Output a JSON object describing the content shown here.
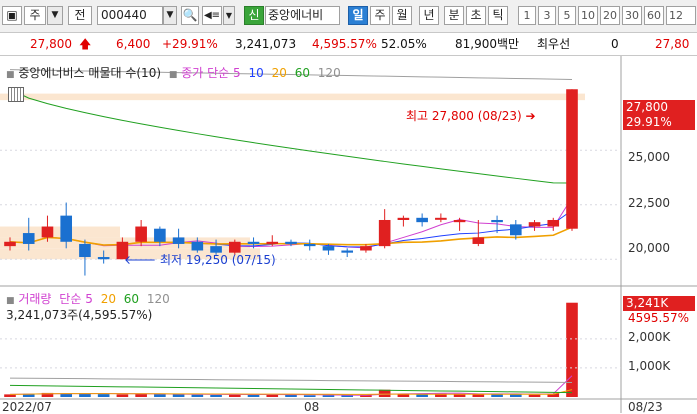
{
  "toolbar": {
    "period": "주",
    "jeon": "전",
    "code": "000440",
    "sin": "신",
    "stock_name": "중앙에너비",
    "tabs": [
      "일",
      "주",
      "월",
      "년",
      "분",
      "초",
      "틱"
    ],
    "numbers": [
      "1",
      "3",
      "5",
      "10",
      "20",
      "30",
      "60",
      "12"
    ]
  },
  "quote": {
    "price": "27,800",
    "change": "6,400",
    "change_pct": "+29.91%",
    "volume": "3,241,073",
    "volume_pct": "4,595.57%",
    "ratio": "52.05%",
    "amount": "81,900백만",
    "best_ask": "최우선",
    "zero": "0",
    "ask_price": "27,80"
  },
  "price_panel": {
    "title": "중앙에너비스 매물대 수(10)",
    "ma_label": "종가 단순",
    "ma_periods": [
      "5",
      "10",
      "20",
      "60",
      "120"
    ],
    "high_label": "최고 27,800 (08/23)",
    "low_label": "최저 19,250 (07/15)",
    "last_price": "27,800",
    "last_pct": "29.91%",
    "y_ticks": [
      "25,000",
      "22,500",
      "20,000"
    ]
  },
  "volume_panel": {
    "title": "거래량",
    "ma_label": "단순",
    "ma_periods": [
      "5",
      "20",
      "60",
      "120"
    ],
    "info": "3,241,073주(4,595.57%)",
    "last_volume": "3,241K",
    "last_pct": "4595.57%",
    "y_ticks": [
      "2,000K",
      "1,000K"
    ]
  },
  "x_axis": {
    "left": "2022/07",
    "mid": "08",
    "right": "08/23"
  },
  "colors": {
    "up": "#e02020",
    "down": "#1a70d0",
    "ma5": "#d040d0",
    "ma10": "#2040ff",
    "ma20": "#f0a000",
    "ma60": "#20a020",
    "ma120": "#a0a0a0"
  },
  "chart_data": {
    "type": "candlestick",
    "x": [
      "07/11",
      "07/12",
      "07/13",
      "07/14",
      "07/15",
      "07/18",
      "07/19",
      "07/20",
      "07/21",
      "07/22",
      "07/25",
      "07/26",
      "07/27",
      "07/28",
      "07/29",
      "08/01",
      "08/02",
      "08/03",
      "08/04",
      "08/05",
      "08/08",
      "08/09",
      "08/10",
      "08/11",
      "08/12",
      "08/16",
      "08/17",
      "08/18",
      "08/19",
      "08/22",
      "08/23"
    ],
    "open": [
      20600,
      21200,
      21000,
      22000,
      20700,
      20100,
      20000,
      20800,
      21400,
      21000,
      20800,
      20600,
      20300,
      20800,
      20700,
      20800,
      20700,
      20600,
      20400,
      20400,
      20600,
      21800,
      21900,
      21900,
      21700,
      20700,
      21800,
      21600,
      21500,
      21500,
      21400
    ],
    "close": [
      20800,
      20700,
      21500,
      20800,
      20100,
      20000,
      20800,
      21500,
      20800,
      20700,
      20400,
      20300,
      20800,
      20700,
      20800,
      20700,
      20600,
      20400,
      20300,
      20600,
      21800,
      21900,
      21700,
      21900,
      21800,
      21000,
      21700,
      21100,
      21700,
      21800,
      27800
    ],
    "high": [
      21000,
      21900,
      22000,
      22600,
      20900,
      20400,
      21000,
      21800,
      21500,
      21400,
      21000,
      20900,
      20900,
      21000,
      21100,
      20900,
      20900,
      20700,
      20500,
      20700,
      22300,
      22000,
      22100,
      22100,
      21900,
      21800,
      22000,
      21800,
      21800,
      21900,
      27800
    ],
    "low": [
      20400,
      20400,
      20800,
      20500,
      19250,
      19800,
      20000,
      20600,
      20600,
      20500,
      20300,
      20200,
      20200,
      20500,
      20600,
      20600,
      20400,
      20200,
      20100,
      20300,
      20500,
      21500,
      21500,
      21700,
      21300,
      20600,
      21200,
      20900,
      21300,
      21300,
      21300
    ],
    "volume": [
      90000,
      110000,
      140000,
      120000,
      130000,
      100000,
      90000,
      110000,
      100000,
      90000,
      80000,
      70000,
      100000,
      80000,
      90000,
      70000,
      60000,
      60000,
      50000,
      60000,
      250000,
      120000,
      100000,
      110000,
      90000,
      120000,
      110000,
      100000,
      80000,
      120000,
      3241073
    ],
    "ylim": [
      19000,
      28500
    ],
    "volume_ylim": [
      0,
      3300000
    ]
  }
}
